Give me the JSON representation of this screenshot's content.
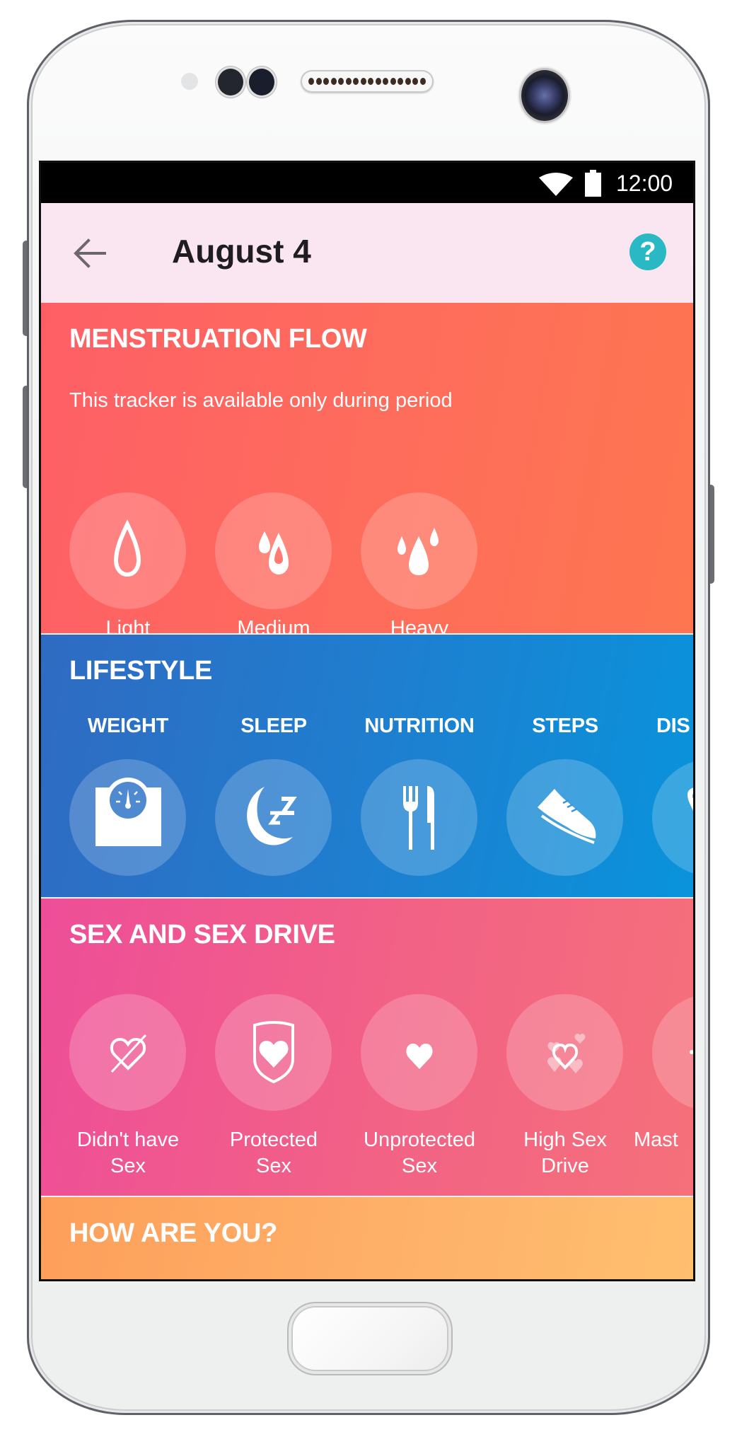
{
  "status_bar": {
    "time": "12:00",
    "wifi_icon": "wifi-icon",
    "battery_icon": "battery-icon"
  },
  "app_bar": {
    "back_icon": "arrow-left-icon",
    "title": "August 4",
    "help_label": "?",
    "help_icon": "help-circle-icon",
    "help_color": "#2BB8C5"
  },
  "menstruation": {
    "title": "MENSTRUATION FLOW",
    "subtitle": "This tracker is available only during period",
    "color_start": "#FE5F66",
    "color_end": "#FE7650",
    "options": [
      {
        "label": "Light",
        "icon": "drop-outline-icon"
      },
      {
        "label": "Medium",
        "icon": "two-drops-icon"
      },
      {
        "label": "Heavy",
        "icon": "three-drops-icon"
      }
    ]
  },
  "lifestyle": {
    "title": "LIFESTYLE",
    "color_start": "#2F6BC2",
    "color_end": "#0993DB",
    "options": [
      {
        "label": "WEIGHT",
        "icon": "scale-icon"
      },
      {
        "label": "SLEEP",
        "icon": "moon-zzz-icon"
      },
      {
        "label": "NUTRITION",
        "icon": "fork-knife-icon"
      },
      {
        "label": "STEPS",
        "icon": "sneaker-icon"
      },
      {
        "label": "DIS",
        "icon": "map-pin-icon"
      }
    ]
  },
  "sex": {
    "title": "SEX AND SEX DRIVE",
    "color_start": "#EE4E98",
    "color_end": "#F5707A",
    "options": [
      {
        "label_line1": "Didn't have",
        "label_line2": "Sex",
        "icon": "heart-crossed-icon"
      },
      {
        "label_line1": "Protected",
        "label_line2": "Sex",
        "icon": "shield-heart-icon"
      },
      {
        "label_line1": "Unprotected",
        "label_line2": "Sex",
        "icon": "heart-icon"
      },
      {
        "label_line1": "High Sex",
        "label_line2": "Drive",
        "icon": "hearts-icon"
      },
      {
        "label_line1": "Mast",
        "label_line2": "",
        "icon": "masturbation-icon"
      }
    ]
  },
  "how_are_you": {
    "title": "HOW ARE YOU?",
    "color_start": "#FD9F5B",
    "color_end": "#FFBF6F"
  }
}
